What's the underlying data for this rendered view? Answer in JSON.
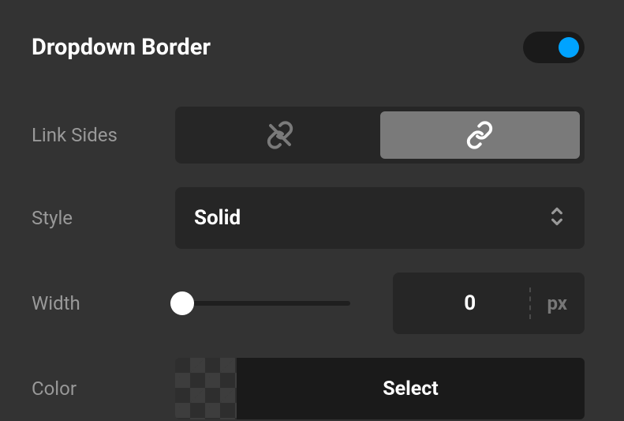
{
  "section": {
    "title": "Dropdown Border",
    "enabled": true
  },
  "link_sides": {
    "label": "Link Sides",
    "options": [
      "unlinked",
      "linked"
    ],
    "active_index": 1
  },
  "style": {
    "label": "Style",
    "value": "Solid"
  },
  "width": {
    "label": "Width",
    "value": "0",
    "unit": "px",
    "min": 0,
    "max": 100
  },
  "color": {
    "label": "Color",
    "button_label": "Select",
    "value": "transparent"
  },
  "colors": {
    "accent": "#00a3ff"
  }
}
